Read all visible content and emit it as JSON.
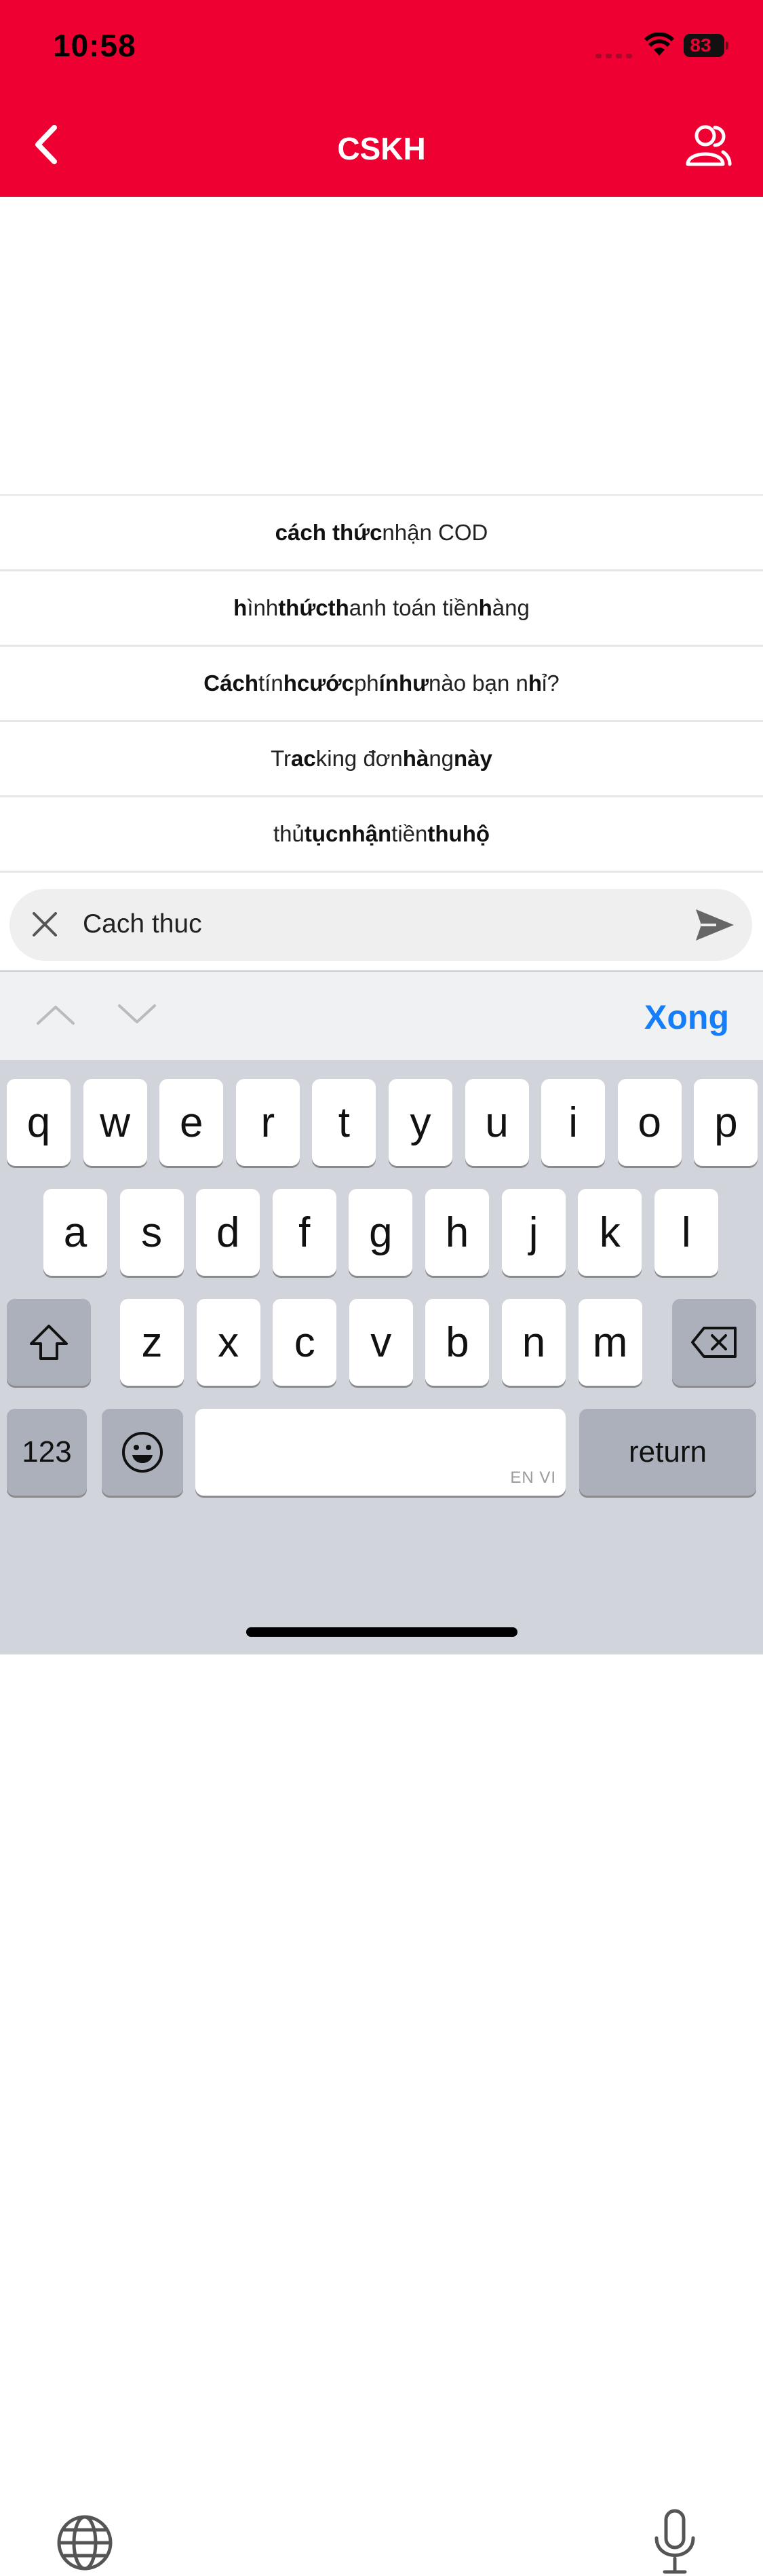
{
  "status_bar": {
    "time": "10:58",
    "battery": "83"
  },
  "header": {
    "title": "CSKH",
    "back_icon": "chevron-left-icon",
    "users_icon": "users-icon",
    "bg_color": "#ee0033"
  },
  "suggestions": [
    {
      "parts": [
        {
          "t": "cách thức",
          "b": true
        },
        {
          "t": " nhận COD",
          "b": false
        }
      ]
    },
    {
      "parts": [
        {
          "t": "h",
          "b": true
        },
        {
          "t": "ình ",
          "b": false
        },
        {
          "t": "thức",
          "b": true
        },
        {
          "t": " ",
          "b": false
        },
        {
          "t": "th",
          "b": true
        },
        {
          "t": "anh toán tiền ",
          "b": false
        },
        {
          "t": "h",
          "b": true
        },
        {
          "t": "à",
          "b": false
        },
        {
          "t": "ng",
          "b": false
        }
      ]
    },
    {
      "parts": [
        {
          "t": "Cách",
          "b": true
        },
        {
          "t": " tín",
          "b": false
        },
        {
          "t": "h",
          "b": true
        },
        {
          "t": " ",
          "b": false
        },
        {
          "t": "cước",
          "b": true
        },
        {
          "t": " ph",
          "b": false
        },
        {
          "t": "í",
          "b": true
        },
        {
          "t": " ",
          "b": false
        },
        {
          "t": "như",
          "b": true
        },
        {
          "t": " nào bạn n",
          "b": false
        },
        {
          "t": "h",
          "b": true
        },
        {
          "t": "ỉ?",
          "b": false
        }
      ]
    },
    {
      "parts": [
        {
          "t": "Tr",
          "b": false
        },
        {
          "t": "ac",
          "b": true
        },
        {
          "t": "king đơn ",
          "b": false
        },
        {
          "t": "hà",
          "b": true
        },
        {
          "t": "ng ",
          "b": false
        },
        {
          "t": "này",
          "b": true
        }
      ]
    },
    {
      "parts": [
        {
          "t": "thủ ",
          "b": false
        },
        {
          "t": "tục",
          "b": true
        },
        {
          "t": " ",
          "b": false
        },
        {
          "t": "nhận",
          "b": true
        },
        {
          "t": " tiền ",
          "b": false
        },
        {
          "t": "thu",
          "b": true
        },
        {
          "t": " ",
          "b": false
        },
        {
          "t": "hộ",
          "b": true
        }
      ]
    }
  ],
  "input": {
    "value": "Cach thuc",
    "clear_icon": "close-icon",
    "send_icon": "send-icon"
  },
  "keyboard": {
    "done_label": "Xong",
    "row1": [
      "q",
      "w",
      "e",
      "r",
      "t",
      "y",
      "u",
      "i",
      "o",
      "p"
    ],
    "row2": [
      "a",
      "s",
      "d",
      "f",
      "g",
      "h",
      "j",
      "k",
      "l"
    ],
    "row3": [
      "z",
      "x",
      "c",
      "v",
      "b",
      "n",
      "m"
    ],
    "numbers_label": "123",
    "return_label": "return",
    "space_hint": "EN VI",
    "accent_color": "#147efb"
  }
}
